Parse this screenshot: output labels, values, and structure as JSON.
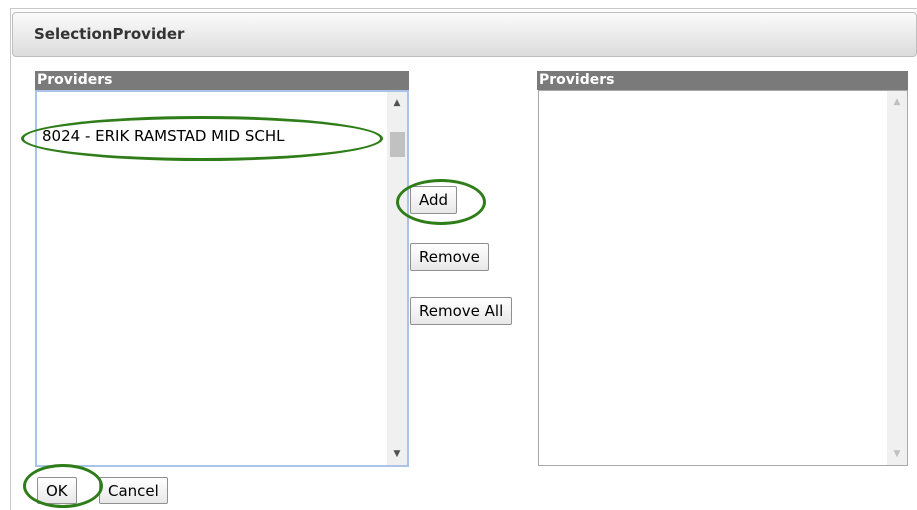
{
  "dialog": {
    "title": "SelectionProvider"
  },
  "available_list": {
    "header": "Providers",
    "items": [
      "8024 - ERIK RAMSTAD MID SCHL"
    ],
    "scroll_up_icon": "triangle-up-icon",
    "scroll_down_icon": "triangle-down-icon"
  },
  "selected_list": {
    "header": "Providers",
    "items": []
  },
  "transfer_buttons": {
    "add_label": "Add",
    "remove_label": "Remove",
    "remove_all_label": "Remove All"
  },
  "footer": {
    "ok_label": "OK",
    "cancel_label": "Cancel"
  },
  "annotations": {
    "highlight_color": "#2e7d18",
    "highlighted": [
      "available-list-item",
      "add-button",
      "ok-button"
    ]
  },
  "colors": {
    "list_header_bg": "#7a7a7a",
    "left_list_border": "#a9c4e8"
  }
}
